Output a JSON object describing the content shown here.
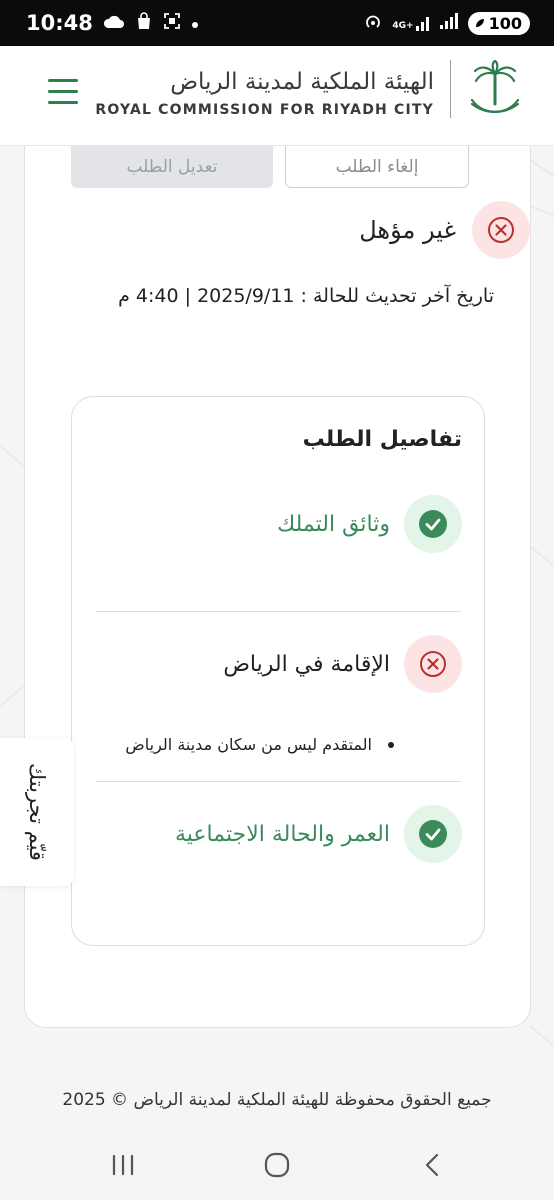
{
  "status_bar": {
    "time": "10:48",
    "network_label": "4G+",
    "battery": "100"
  },
  "header": {
    "brand_ar": "الهيئة الملكية لمدينة الرياض",
    "brand_en": "ROYAL COMMISSION FOR RIYADH CITY"
  },
  "actions": {
    "edit_label": "تعديل الطلب",
    "cancel_label": "إلغاء الطلب"
  },
  "status": {
    "label": "غير مؤهل",
    "last_update": "تاريخ آخر تحديث للحالة : 2025/9/11 | 4:40 م"
  },
  "details": {
    "title": "تفاصيل الطلب",
    "items": [
      {
        "label": "وثائق التملك",
        "state": "pass"
      },
      {
        "label": "الإقامة في الرياض",
        "state": "fail",
        "reasons": [
          "المتقدم ليس من سكان مدينة الرياض"
        ]
      },
      {
        "label": "العمر والحالة الاجتماعية",
        "state": "pass"
      }
    ]
  },
  "feedback": {
    "label": "قيّم تجربتك"
  },
  "footer": {
    "text": "جميع الحقوق محفوظة للهيئة الملكية لمدينة الرياض © 2025"
  },
  "colors": {
    "brand_green": "#2e7d4f",
    "pass_green": "#3a8a5a",
    "fail_red": "#b83232"
  }
}
